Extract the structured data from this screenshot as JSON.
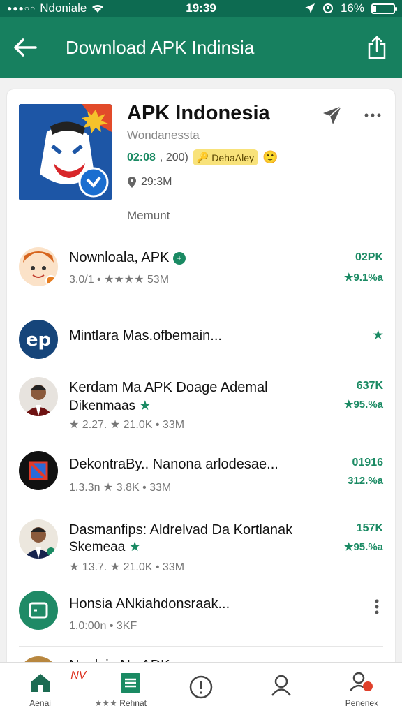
{
  "status_bar": {
    "carrier": "Ndoniale",
    "time": "19:39",
    "battery": "16%",
    "battery_level": 0.16
  },
  "app_bar": {
    "title": "Download APK Indinsia"
  },
  "hero": {
    "title": "APK Indonesia",
    "developer": "Wondanessta",
    "version": "02:08",
    "count": ", 200)",
    "chip": "DehaAley",
    "size": "29:3M",
    "moment": "Memunt"
  },
  "rows": [
    {
      "name": "Nownloala, APK",
      "meta": "3.0/1 • ★★★★ 53M",
      "rank": "02PK",
      "score": "★9.1%a"
    },
    {
      "name": "Mintlara Mas.ofbemain..."
    },
    {
      "name": "Kerdam Ma APK Doage Ademal",
      "name2": "Dikenmaas",
      "meta": "★ 2.27. ★ 21.0K • 33M",
      "rank": "637K",
      "score": "★95.%a"
    },
    {
      "name": "DekontraBy.. Nanona arlodesae...",
      "meta": "1.3.3n ★ 3.8K • 33M",
      "rank": "01916",
      "score": "312.%a"
    },
    {
      "name": "Dasmanfips: Aldrelvad Da Kortlanak",
      "name2": "Skemeaa",
      "meta": "★ 13.7. ★ 21.0K • 33M",
      "rank": "157K",
      "score": "★95.%a"
    },
    {
      "name": "Honsia ANkiahdonsraak...",
      "meta": "1.0:00n • 3KF"
    },
    {
      "name": "Nunlaia Na ADK"
    }
  ],
  "bottom_nav": [
    {
      "label": "Aenai"
    },
    {
      "label": "Rehnat",
      "badge": "NV"
    },
    {
      "label": ""
    },
    {
      "label": ""
    },
    {
      "label": "Penenek"
    }
  ],
  "colors": {
    "primary": "#17805f",
    "status": "#0d6b51",
    "accent": "#1a8a63"
  }
}
